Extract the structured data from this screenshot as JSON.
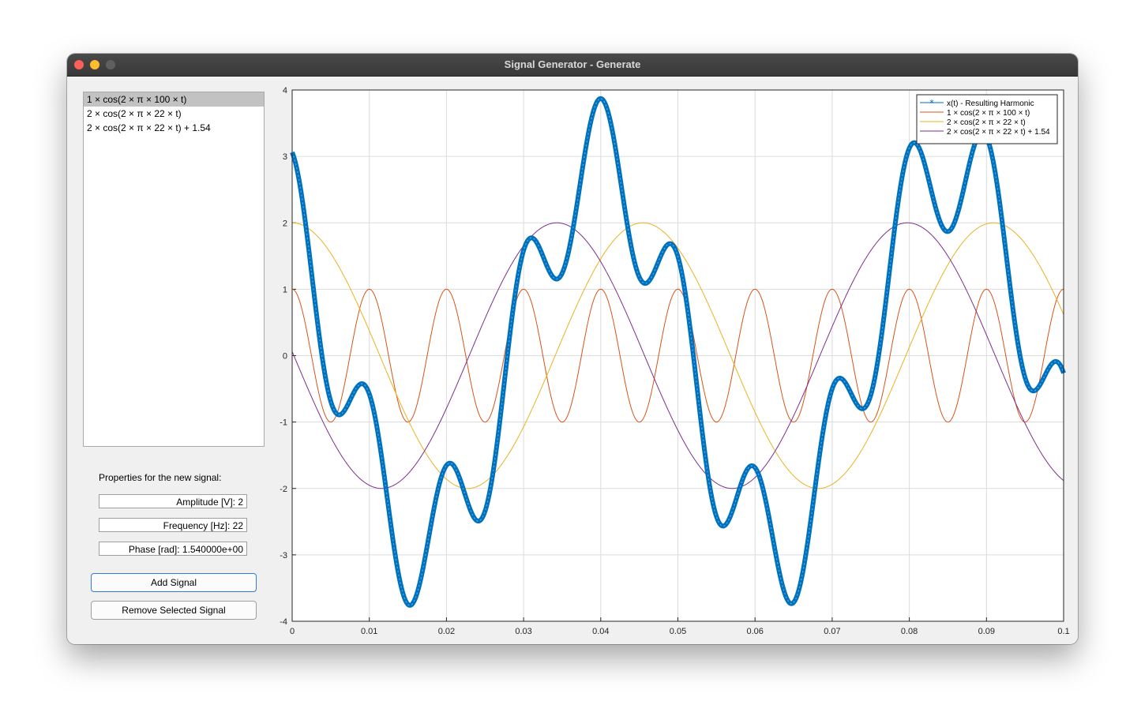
{
  "window": {
    "title": "Signal Generator - Generate"
  },
  "signal_list": {
    "items": [
      "1 × cos(2 × π × 100 × t)",
      "2 × cos(2 × π × 22 × t)",
      "2 × cos(2 × π × 22 × t) + 1.54"
    ],
    "selected_index": 0
  },
  "properties": {
    "heading": "Properties for the new signal:",
    "amplitude": "Amplitude [V]: 2",
    "frequency": "Frequency [Hz]: 22",
    "phase": "Phase [rad]: 1.540000e+00"
  },
  "buttons": {
    "add": "Add Signal",
    "remove": "Remove Selected Signal"
  },
  "chart_data": {
    "type": "line",
    "xlim": [
      0,
      0.1
    ],
    "ylim": [
      -4,
      4
    ],
    "x_ticks": [
      "0",
      "0.01",
      "0.02",
      "0.03",
      "0.04",
      "0.05",
      "0.06",
      "0.07",
      "0.08",
      "0.09",
      "0.1"
    ],
    "y_ticks": [
      "4",
      "3",
      "2",
      "1",
      "0",
      "-1",
      "-2",
      "-3",
      "-4"
    ],
    "grid": true,
    "legend_position": "top-right",
    "series": [
      {
        "name": "x(t) - Resulting Harmonic",
        "color": "#0072BD",
        "amplitude": "sum",
        "frequency": "sum",
        "phase": "sum",
        "marker": "asterisk"
      },
      {
        "name": "1 × cos(2 × π × 100 × t)",
        "color": "#D95319",
        "amplitude": 1,
        "frequency": 100,
        "phase": 0
      },
      {
        "name": "2 × cos(2 × π × 22 × t)",
        "color": "#EDB120",
        "amplitude": 2,
        "frequency": 22,
        "phase": 0
      },
      {
        "name": "2 × cos(2 × π × 22 × t) + 1.54",
        "color": "#7E2F8E",
        "amplitude": 2,
        "frequency": 22,
        "phase": 1.54
      }
    ]
  }
}
